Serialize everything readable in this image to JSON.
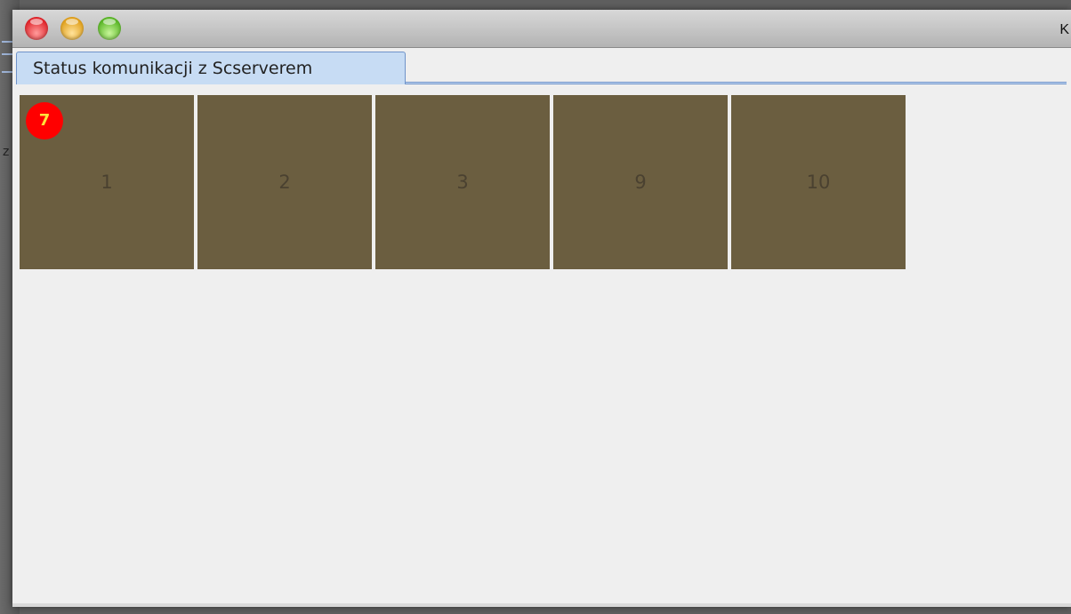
{
  "window": {
    "title_fragment": "K",
    "controls": {
      "close": {
        "icon": "close-traffic-light-icon",
        "color": "#e0242a"
      },
      "minimize": {
        "icon": "minimize-traffic-light-icon",
        "color": "#e0a01c"
      },
      "zoom": {
        "icon": "zoom-traffic-light-icon",
        "color": "#59b626"
      }
    }
  },
  "background": {
    "letter": "z"
  },
  "tabs": [
    {
      "label": "Status komunikacji z Scserverem",
      "selected": true
    }
  ],
  "tiles": [
    {
      "label": "1",
      "badge": "7",
      "color": "#6b5e40"
    },
    {
      "label": "2",
      "color": "#6b5e40"
    },
    {
      "label": "3",
      "color": "#6b5e40"
    },
    {
      "label": "9",
      "color": "#6b5e40"
    },
    {
      "label": "10",
      "color": "#6b5e40"
    }
  ],
  "colors": {
    "badge": "#ff0000",
    "badge_text": "#ffe23a",
    "tab_selected": "#c7dcf4",
    "panel_background": "#efefef"
  }
}
